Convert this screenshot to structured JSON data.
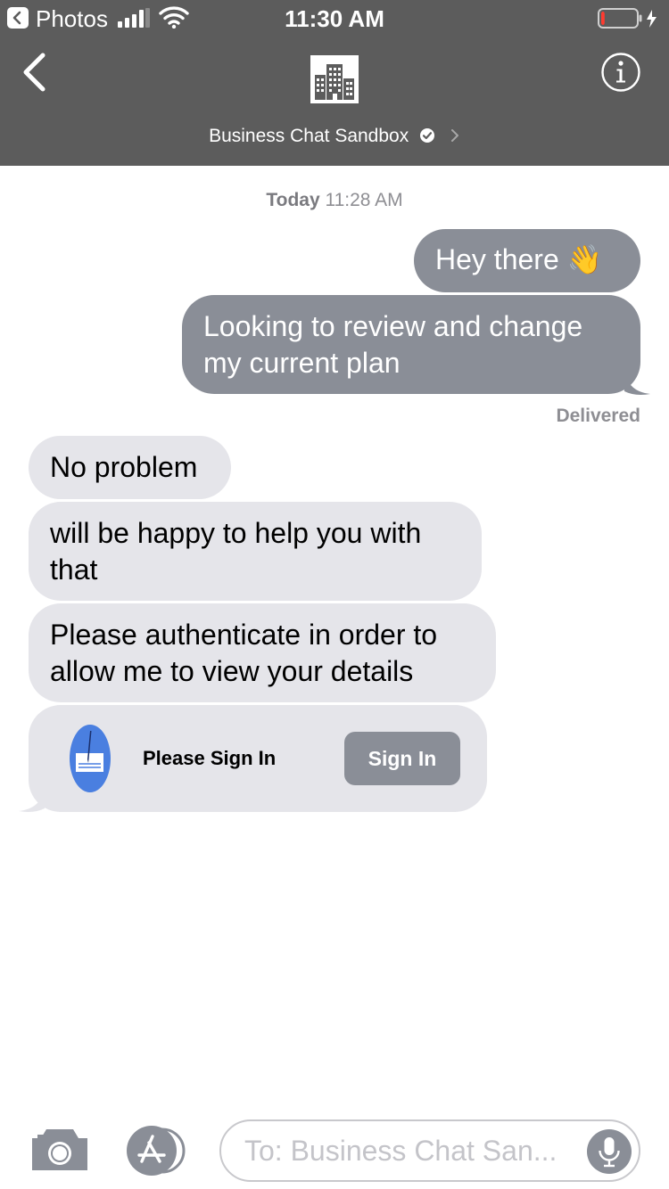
{
  "status_bar": {
    "back_app_label": "Photos",
    "time": "11:30 AM",
    "battery_level": 0.1
  },
  "header": {
    "contact_name": "Business Chat Sandbox",
    "verified": true,
    "avatar_icon": "building-icon"
  },
  "thread": {
    "timestamp_day": "Today",
    "timestamp_time": "11:28 AM",
    "outgoing": [
      {
        "text": "Hey there",
        "emoji": "👋"
      },
      {
        "text": "Looking to review and change my current plan"
      }
    ],
    "delivered_label": "Delivered",
    "incoming": [
      {
        "text": "No problem"
      },
      {
        "text": "will be happy to help you with that"
      },
      {
        "text": "Please authenticate in order to allow me to view your details"
      }
    ],
    "auth_card": {
      "title": "Please Sign In",
      "button_label": "Sign In",
      "icon": "signature-icon"
    }
  },
  "input_bar": {
    "placeholder": "To: Business Chat San..."
  },
  "colors": {
    "header_bg": "#5c5c5c",
    "outgoing_bubble": "#8a8e97",
    "incoming_bubble": "#e5e5ea",
    "card_icon_blue": "#4a7fe0",
    "battery_low": "#ff3b30"
  }
}
